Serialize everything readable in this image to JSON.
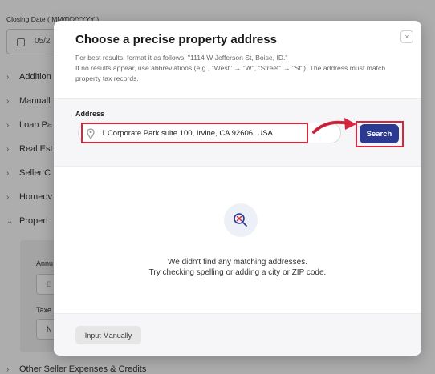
{
  "background": {
    "closing_label": "Closing Date ( MM/DD/YYYY )",
    "closing_value": "05/2",
    "sections": [
      "Addition",
      "Manuall",
      "Loan Pa",
      "Real Est",
      "Seller C",
      "Homeov",
      "Propert"
    ],
    "annual_label": "Annu",
    "input_placeholder": "E",
    "taxes_label": "Taxe",
    "select_value": "N",
    "bottom_section": "Other Seller Expenses & Credits"
  },
  "modal": {
    "title": "Choose a precise property address",
    "close_label": "×",
    "desc_line1": "For best results, format it as follows: \"1114 W Jefferson St, Boise, ID.\"",
    "desc_line2": "If no results appear, use abbreviations (e.g., \"West\" → \"W\", \"Street\" → \"St\"). The address must match property tax records.",
    "address_label": "Address",
    "address_value": "1 Corporate Park suite 100, Irvine, CA 92606, USA",
    "search_label": "Search",
    "empty_line1": "We didn't find any matching addresses.",
    "empty_line2": "Try checking spelling or adding a city or ZIP code.",
    "manual_button": "Input Manually"
  },
  "colors": {
    "accent": "#2b3990",
    "annotation": "#d7263d"
  }
}
